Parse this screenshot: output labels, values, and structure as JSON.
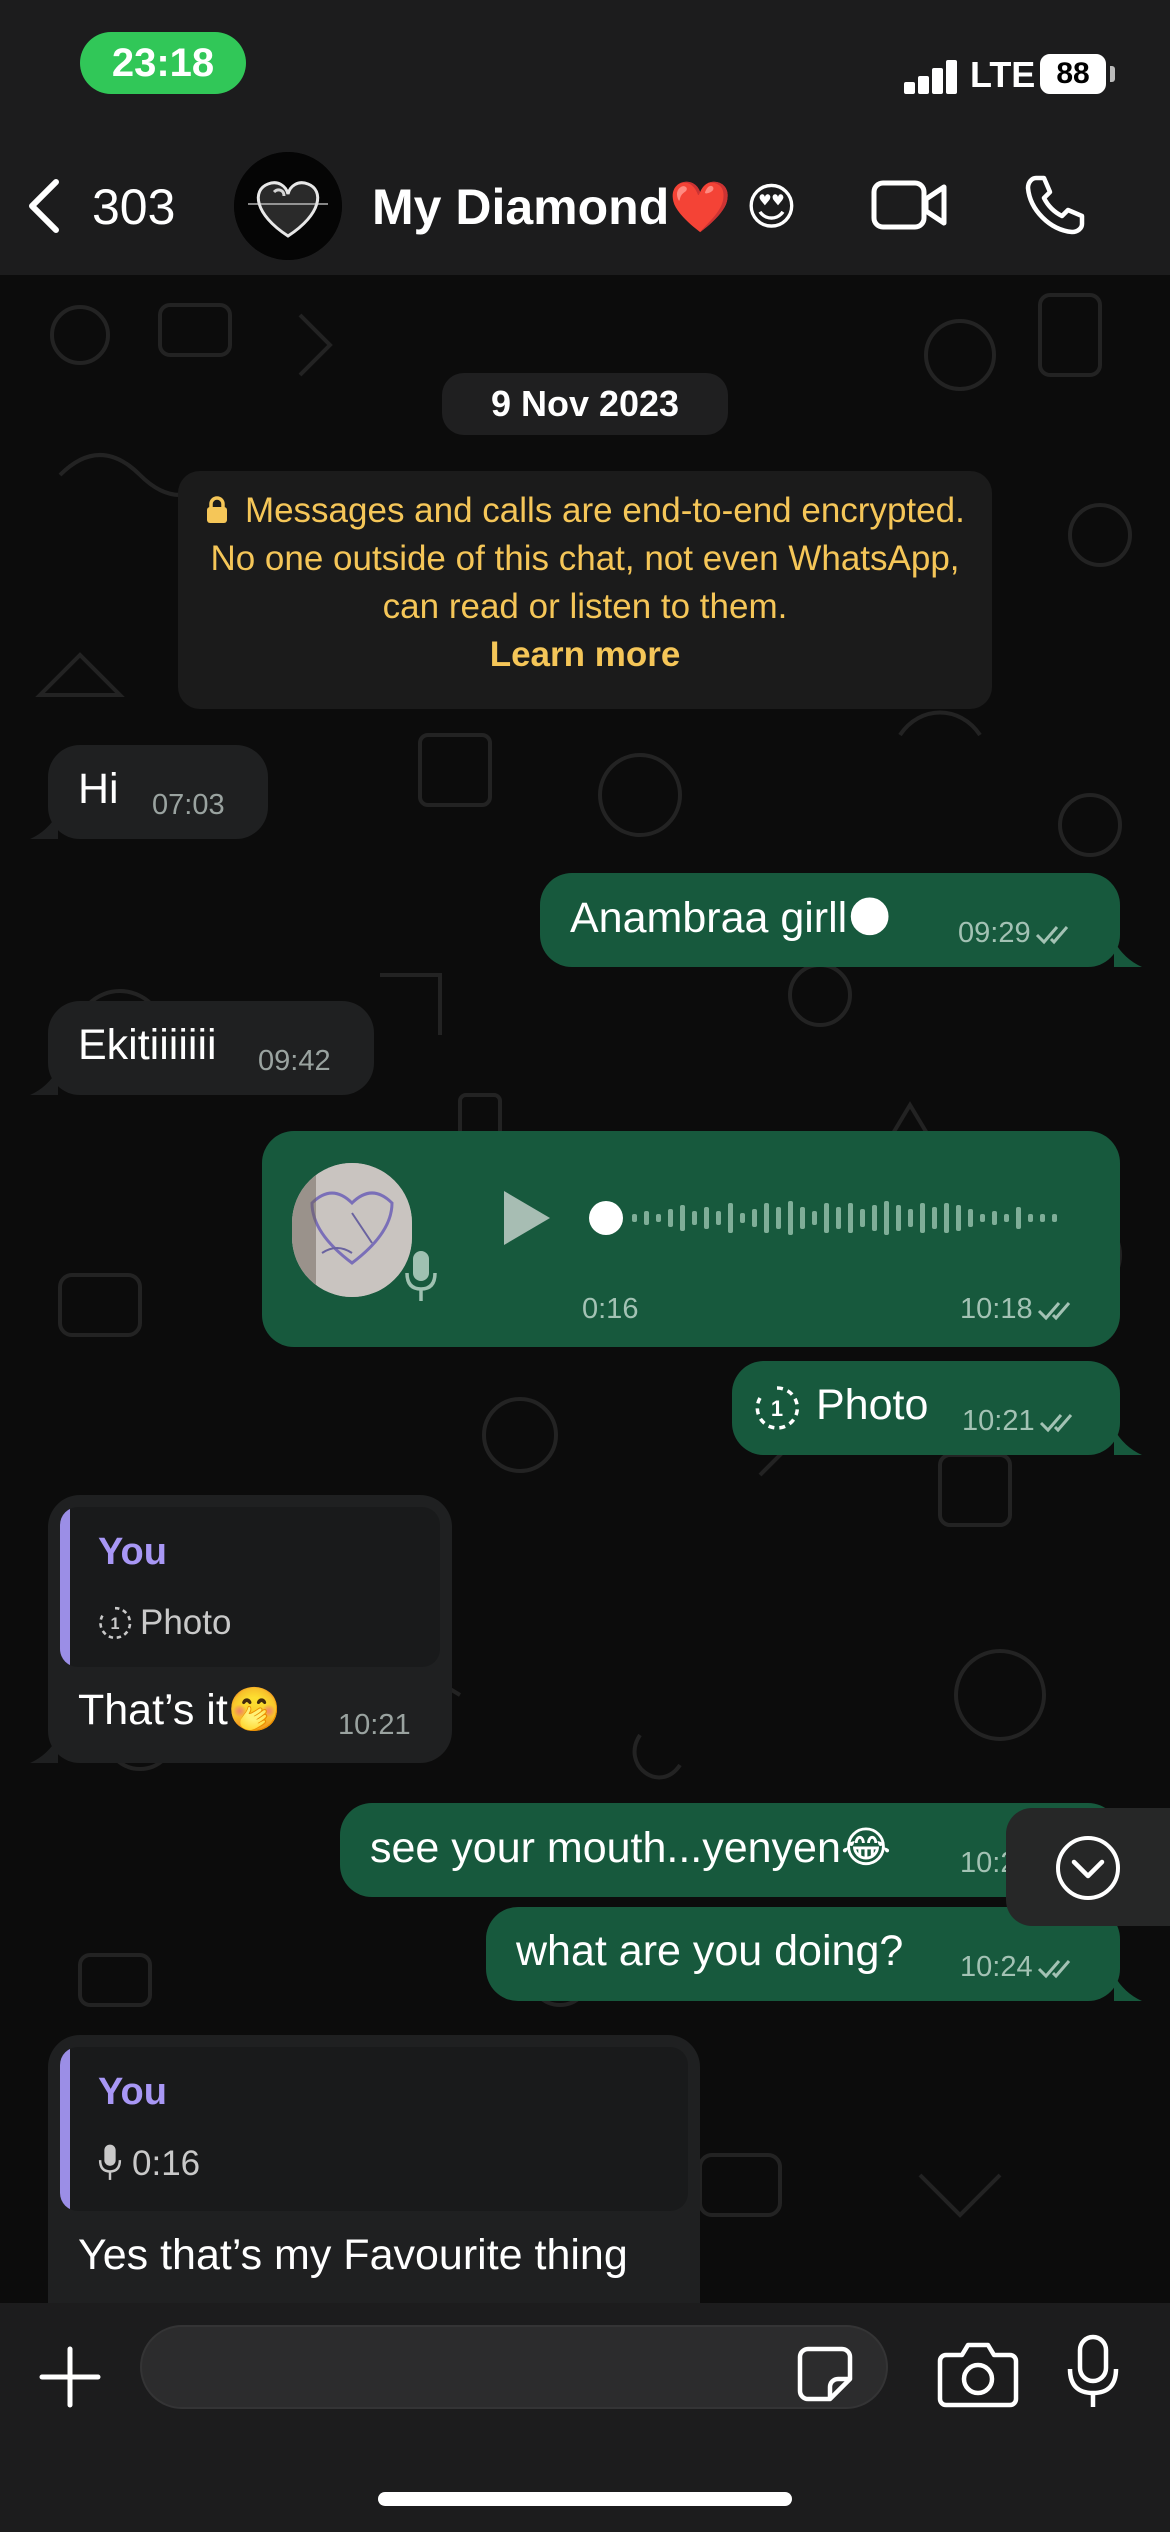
{
  "status_bar": {
    "time": "23:18",
    "network": "LTE",
    "battery": "88"
  },
  "header": {
    "back_count": "303",
    "contact_name": "My Diamond❤️ 😍"
  },
  "chat": {
    "date": "9 Nov 2023",
    "encryption_notice": "Messages and calls are end-to-end encrypted. No one outside of this chat, not even WhatsApp, can read or listen to them.",
    "learn_more": "Learn more",
    "messages": [
      {
        "dir": "in",
        "text": "Hi",
        "time": "07:03"
      },
      {
        "dir": "out",
        "text": "Anambraa girll🌑",
        "time": "09:29"
      },
      {
        "dir": "in",
        "text": "Ekitiiiiiii",
        "time": "09:42"
      },
      {
        "dir": "out",
        "type": "voice",
        "duration": "0:16",
        "time": "10:18",
        "progress": 0.0
      },
      {
        "dir": "out",
        "type": "view-once-photo",
        "text": "Photo",
        "time": "10:21"
      },
      {
        "dir": "in",
        "quote_author": "You",
        "quote_text": "Photo",
        "text": "That’s it🤭",
        "time": "10:21"
      },
      {
        "dir": "out",
        "text": "see your mouth...yenyen😂",
        "time": "10:24"
      },
      {
        "dir": "out",
        "text": "what are you doing?",
        "time": "10:24"
      },
      {
        "dir": "in",
        "quote_author": "You",
        "quote_text": "0:16",
        "text": "Yes that’s my Favourite thing"
      }
    ]
  },
  "input": {
    "placeholder": ""
  },
  "colors": {
    "incoming": "#1f2021",
    "outgoing": "#17593d",
    "notice_text": "#f5c658",
    "quote_accent": "#9b8ee6",
    "status_pill": "#31c758"
  }
}
